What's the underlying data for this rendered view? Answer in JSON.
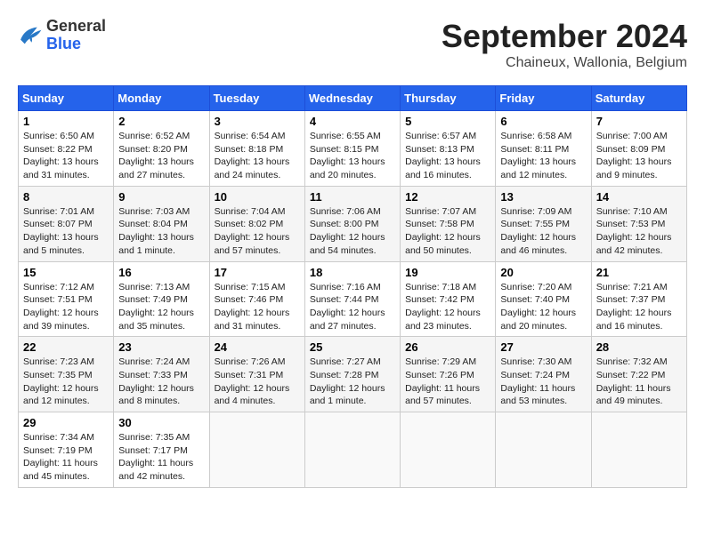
{
  "header": {
    "logo_general": "General",
    "logo_blue": "Blue",
    "month_title": "September 2024",
    "subtitle": "Chaineux, Wallonia, Belgium"
  },
  "weekdays": [
    "Sunday",
    "Monday",
    "Tuesday",
    "Wednesday",
    "Thursday",
    "Friday",
    "Saturday"
  ],
  "weeks": [
    [
      {
        "day": "1",
        "info": "Sunrise: 6:50 AM\nSunset: 8:22 PM\nDaylight: 13 hours\nand 31 minutes."
      },
      {
        "day": "2",
        "info": "Sunrise: 6:52 AM\nSunset: 8:20 PM\nDaylight: 13 hours\nand 27 minutes."
      },
      {
        "day": "3",
        "info": "Sunrise: 6:54 AM\nSunset: 8:18 PM\nDaylight: 13 hours\nand 24 minutes."
      },
      {
        "day": "4",
        "info": "Sunrise: 6:55 AM\nSunset: 8:15 PM\nDaylight: 13 hours\nand 20 minutes."
      },
      {
        "day": "5",
        "info": "Sunrise: 6:57 AM\nSunset: 8:13 PM\nDaylight: 13 hours\nand 16 minutes."
      },
      {
        "day": "6",
        "info": "Sunrise: 6:58 AM\nSunset: 8:11 PM\nDaylight: 13 hours\nand 12 minutes."
      },
      {
        "day": "7",
        "info": "Sunrise: 7:00 AM\nSunset: 8:09 PM\nDaylight: 13 hours\nand 9 minutes."
      }
    ],
    [
      {
        "day": "8",
        "info": "Sunrise: 7:01 AM\nSunset: 8:07 PM\nDaylight: 13 hours\nand 5 minutes."
      },
      {
        "day": "9",
        "info": "Sunrise: 7:03 AM\nSunset: 8:04 PM\nDaylight: 13 hours\nand 1 minute."
      },
      {
        "day": "10",
        "info": "Sunrise: 7:04 AM\nSunset: 8:02 PM\nDaylight: 12 hours\nand 57 minutes."
      },
      {
        "day": "11",
        "info": "Sunrise: 7:06 AM\nSunset: 8:00 PM\nDaylight: 12 hours\nand 54 minutes."
      },
      {
        "day": "12",
        "info": "Sunrise: 7:07 AM\nSunset: 7:58 PM\nDaylight: 12 hours\nand 50 minutes."
      },
      {
        "day": "13",
        "info": "Sunrise: 7:09 AM\nSunset: 7:55 PM\nDaylight: 12 hours\nand 46 minutes."
      },
      {
        "day": "14",
        "info": "Sunrise: 7:10 AM\nSunset: 7:53 PM\nDaylight: 12 hours\nand 42 minutes."
      }
    ],
    [
      {
        "day": "15",
        "info": "Sunrise: 7:12 AM\nSunset: 7:51 PM\nDaylight: 12 hours\nand 39 minutes."
      },
      {
        "day": "16",
        "info": "Sunrise: 7:13 AM\nSunset: 7:49 PM\nDaylight: 12 hours\nand 35 minutes."
      },
      {
        "day": "17",
        "info": "Sunrise: 7:15 AM\nSunset: 7:46 PM\nDaylight: 12 hours\nand 31 minutes."
      },
      {
        "day": "18",
        "info": "Sunrise: 7:16 AM\nSunset: 7:44 PM\nDaylight: 12 hours\nand 27 minutes."
      },
      {
        "day": "19",
        "info": "Sunrise: 7:18 AM\nSunset: 7:42 PM\nDaylight: 12 hours\nand 23 minutes."
      },
      {
        "day": "20",
        "info": "Sunrise: 7:20 AM\nSunset: 7:40 PM\nDaylight: 12 hours\nand 20 minutes."
      },
      {
        "day": "21",
        "info": "Sunrise: 7:21 AM\nSunset: 7:37 PM\nDaylight: 12 hours\nand 16 minutes."
      }
    ],
    [
      {
        "day": "22",
        "info": "Sunrise: 7:23 AM\nSunset: 7:35 PM\nDaylight: 12 hours\nand 12 minutes."
      },
      {
        "day": "23",
        "info": "Sunrise: 7:24 AM\nSunset: 7:33 PM\nDaylight: 12 hours\nand 8 minutes."
      },
      {
        "day": "24",
        "info": "Sunrise: 7:26 AM\nSunset: 7:31 PM\nDaylight: 12 hours\nand 4 minutes."
      },
      {
        "day": "25",
        "info": "Sunrise: 7:27 AM\nSunset: 7:28 PM\nDaylight: 12 hours\nand 1 minute."
      },
      {
        "day": "26",
        "info": "Sunrise: 7:29 AM\nSunset: 7:26 PM\nDaylight: 11 hours\nand 57 minutes."
      },
      {
        "day": "27",
        "info": "Sunrise: 7:30 AM\nSunset: 7:24 PM\nDaylight: 11 hours\nand 53 minutes."
      },
      {
        "day": "28",
        "info": "Sunrise: 7:32 AM\nSunset: 7:22 PM\nDaylight: 11 hours\nand 49 minutes."
      }
    ],
    [
      {
        "day": "29",
        "info": "Sunrise: 7:34 AM\nSunset: 7:19 PM\nDaylight: 11 hours\nand 45 minutes."
      },
      {
        "day": "30",
        "info": "Sunrise: 7:35 AM\nSunset: 7:17 PM\nDaylight: 11 hours\nand 42 minutes."
      },
      {
        "day": "",
        "info": ""
      },
      {
        "day": "",
        "info": ""
      },
      {
        "day": "",
        "info": ""
      },
      {
        "day": "",
        "info": ""
      },
      {
        "day": "",
        "info": ""
      }
    ]
  ]
}
